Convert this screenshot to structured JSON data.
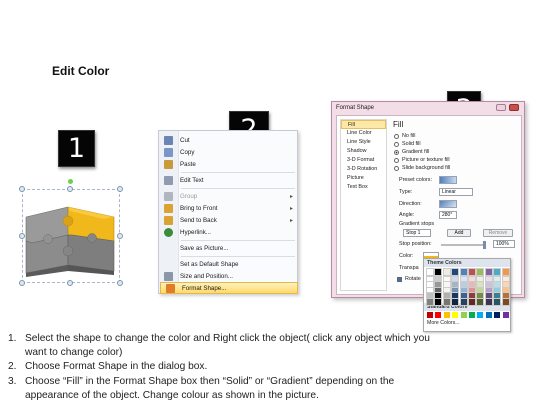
{
  "page": {
    "title": "Edit Color"
  },
  "steps": [
    {
      "num": "1",
      "label": "1"
    },
    {
      "num": "2",
      "label": "2"
    },
    {
      "num": "3",
      "label": "3"
    }
  ],
  "context_menu": {
    "items": [
      {
        "label": "Cut",
        "icon": "scissors-icon",
        "color": "#6a85b5"
      },
      {
        "label": "Copy",
        "icon": "copy-icon",
        "color": "#7a96c5"
      },
      {
        "label": "Paste",
        "icon": "paste-icon",
        "color": "#c99a3b"
      },
      {
        "label": "Edit Text",
        "icon": "edit-text-icon",
        "color": "#8e9bb0"
      },
      {
        "label": "Group",
        "icon": "group-icon",
        "color": "#b0b6c0",
        "disabled": true,
        "submenu": true
      },
      {
        "label": "Bring to Front",
        "icon": "bring-front-icon",
        "color": "#d9a232",
        "submenu": true
      },
      {
        "label": "Send to Back",
        "icon": "send-back-icon",
        "color": "#d9a232",
        "submenu": true
      },
      {
        "label": "Hyperlink...",
        "icon": "hyperlink-icon",
        "color": "#3b8b3b"
      },
      {
        "label": "Save as Picture...",
        "icon": "none"
      },
      {
        "label": "Set as Default Shape",
        "icon": "none"
      },
      {
        "label": "Size and Position...",
        "icon": "size-position-icon",
        "color": "#8b97a8"
      },
      {
        "label": "Format Shape...",
        "icon": "format-shape-icon",
        "color": "#e07b2a",
        "highlighted": true
      }
    ]
  },
  "dialog": {
    "title": "Format Shape",
    "nav_items": [
      "Fill",
      "Line Color",
      "Line Style",
      "Shadow",
      "3-D Format",
      "3-D Rotation",
      "Picture",
      "Text Box"
    ],
    "pane_title": "Fill",
    "fill_options": [
      "No fill",
      "Solid fill",
      "Gradient fill",
      "Picture or texture fill",
      "Slide background fill"
    ],
    "preset_colors_label": "Preset colors:",
    "type_label": "Type:",
    "type_value": "Linear",
    "direction_label": "Direction:",
    "angle_label": "Angle:",
    "angle_value": "280°",
    "gradient_stops_label": "Gradient stops",
    "stop_value": "Stop 1",
    "add_label": "Add",
    "remove_label": "Remove",
    "stop_position_label": "Stop position:",
    "stop_position_value": "100%",
    "color_label": "Color:",
    "transparency_label": "Transpa",
    "rotate_label": "Rotate",
    "palette": {
      "theme_colors_label": "Theme Colors",
      "standard_colors_label": "Standard Colors",
      "more_colors_label": "More Colors...",
      "theme_row": [
        "#ffffff",
        "#000000",
        "#eeece1",
        "#1f497d",
        "#4f81bd",
        "#c0504d",
        "#9bbb59",
        "#8064a2",
        "#4bacc6",
        "#f79646"
      ],
      "standard_row": [
        "#c00000",
        "#ff0000",
        "#ffc000",
        "#ffff00",
        "#92d050",
        "#00b050",
        "#00b0f0",
        "#0070c0",
        "#002060",
        "#7030a0"
      ]
    }
  },
  "instructions": [
    {
      "num": "1.",
      "lines": [
        "Select the shape to change the color and Right click the object( click any object which you",
        "want to change color)"
      ]
    },
    {
      "num": "2.",
      "lines": [
        "Choose Format Shape in the dialog box."
      ]
    },
    {
      "num": "3.",
      "lines": [
        "Choose “Fill” in the Format Shape box then “Solid” or “Gradient” depending on the",
        "appearance of the object. Change colour as shown in the picture."
      ]
    }
  ],
  "colors": {
    "puzzle_gray": "#8c8c8c",
    "puzzle_yellow": "#f0b81a",
    "menu_highlight": "#ffd96a",
    "dialog_frame": "#f3dde6"
  }
}
